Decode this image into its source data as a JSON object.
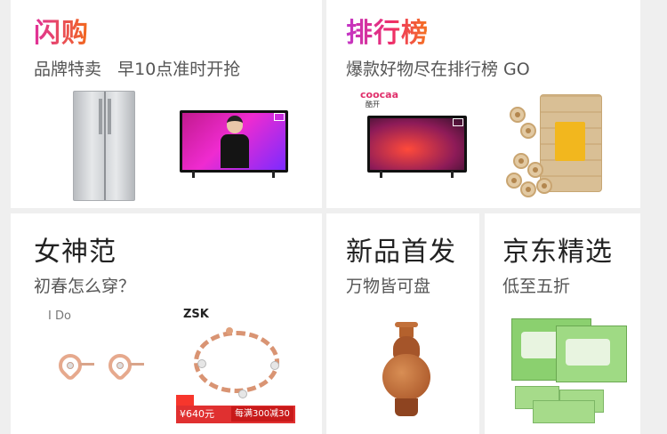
{
  "cards": {
    "flash": {
      "title": "闪购",
      "subtitle": "品牌特卖   早10点准时开抢"
    },
    "ranking": {
      "title": "排行榜",
      "subtitle": "爆款好物尽在排行榜 GO"
    },
    "goddess": {
      "title": "女神范",
      "subtitle": "初春怎么穿？"
    },
    "new_products": {
      "title": "新品首发",
      "subtitle": "万物皆可盘"
    },
    "jd_select": {
      "title": "京东精选",
      "subtitle": "低至五折"
    }
  },
  "product_marks": {
    "coocaa_brand": "coocaa",
    "coocaa_cn": "酷开",
    "earring_brand": "I Do",
    "bracelet_brand": "ZSK",
    "bracelet_price": "¥640元",
    "bracelet_promo": "每满300减30"
  },
  "colors": {
    "title_gradient_start": "#e0309a",
    "title_gradient_end": "#f26a1b",
    "background": "#efefef",
    "card": "#ffffff"
  }
}
